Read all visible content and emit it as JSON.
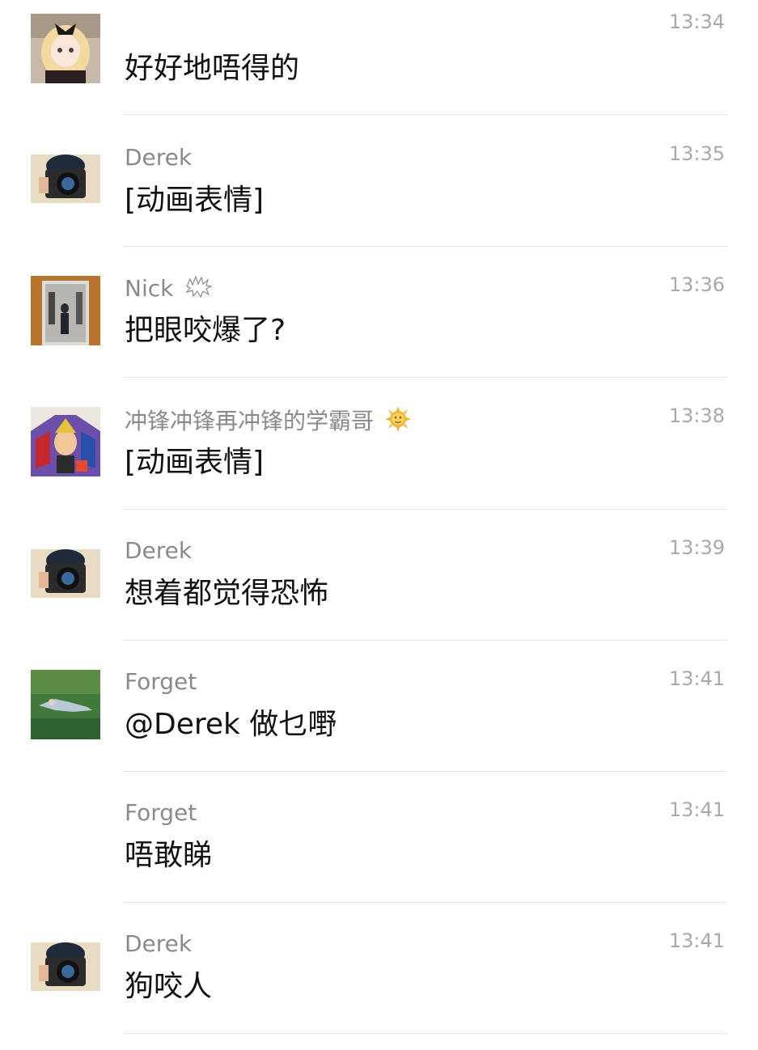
{
  "messages": [
    {
      "sender": "",
      "text": "好好地唔得的",
      "time": "13:34",
      "avatar": "anime-girl-avatar"
    },
    {
      "sender": "Derek",
      "text": "[动画表情]",
      "time": "13:35",
      "avatar": "camera-person-avatar"
    },
    {
      "sender": "Nick",
      "text": "把眼咬爆了?",
      "time": "13:36",
      "avatar": "mirror-selfie-avatar",
      "badge": "scribble-badge-icon"
    },
    {
      "sender": "冲锋冲锋再冲锋的学霸哥",
      "text": "[动画表情]",
      "time": "13:38",
      "avatar": "anime-hero-avatar",
      "badge": "sun-face-emoji-icon"
    },
    {
      "sender": "Derek",
      "text": "想着都觉得恐怖",
      "time": "13:39",
      "avatar": "camera-person-avatar"
    },
    {
      "sender": "Forget",
      "text": "@Derek 做乜嘢",
      "time": "13:41",
      "avatar": "grass-field-avatar"
    },
    {
      "sender": "Forget",
      "text": "唔敢睇",
      "time": "13:41",
      "avatar": ""
    },
    {
      "sender": "Derek",
      "text": "狗咬人",
      "time": "13:41",
      "avatar": "camera-person-avatar"
    }
  ],
  "colors": {
    "sender": "#8a8a8a",
    "text": "#111111",
    "time": "#a9a9a9",
    "divider": "#e5e5e5"
  }
}
